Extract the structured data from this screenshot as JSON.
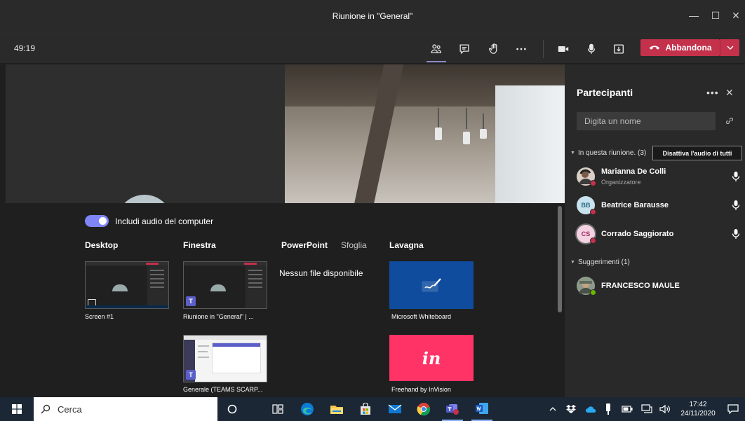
{
  "window": {
    "title": "Riunione in \"General\"",
    "controls": {
      "minimize": "—",
      "maximize": "☐",
      "close": "✕"
    }
  },
  "toolbar": {
    "timer": "49:19",
    "buttons": [
      {
        "name": "participants-icon",
        "active": true
      },
      {
        "name": "chat-icon"
      },
      {
        "name": "raise-hand-icon"
      },
      {
        "name": "more-icon"
      },
      {
        "name": "camera-icon"
      },
      {
        "name": "microphone-icon"
      },
      {
        "name": "share-tray-icon"
      }
    ],
    "leave_label": "Abbandona"
  },
  "share_tray": {
    "include_audio_label": "Includi audio del computer",
    "include_audio_on": true,
    "columns": {
      "desktop": "Desktop",
      "window": "Finestra",
      "powerpoint": "PowerPoint",
      "browse": "Sfoglia",
      "whiteboard": "Lavagna"
    },
    "desktop_items": [
      "Screen #1"
    ],
    "window_items": [
      "Riunione in \"General\" | ...",
      "Generale (TEAMS SCARP..."
    ],
    "powerpoint_empty": "Nessun file disponibile",
    "whiteboard_items": [
      "Microsoft Whiteboard",
      "Freehand by InVision"
    ],
    "invision_logo": "in"
  },
  "participants": {
    "title": "Partecipanti",
    "more": "•••",
    "close": "✕",
    "search_placeholder": "Digita un nome",
    "in_meeting_label": "In questa riunione. (3)",
    "mute_all_label": "Disattiva l'audio di tutti",
    "in_meeting": [
      {
        "name": "Marianna De Colli",
        "role": "Organizzatore",
        "avatar": "photo",
        "status_color": "#c4314b",
        "mic": true
      },
      {
        "name": "Beatrice Barausse",
        "initials": "BB",
        "avatar_bg": "#c9e3ee",
        "avatar_fg": "#2c6a86",
        "status_color": "#c4314b",
        "mic": true
      },
      {
        "name": "Corrado Saggiorato",
        "initials": "CS",
        "avatar_bg": "#f4d2e1",
        "avatar_fg": "#a02b60",
        "status_color": "#c4314b",
        "mic": true
      }
    ],
    "suggestions_label": "Suggerimenti (1)",
    "suggestions": [
      {
        "name": "FRANCESCO MAULE",
        "avatar": "photo",
        "status_color": "#6bb700"
      }
    ]
  },
  "taskbar": {
    "search_placeholder": "Cerca",
    "time": "17:42",
    "date": "24/11/2020"
  },
  "colors": {
    "accent": "#7f85f5",
    "leave": "#c4314b",
    "panel": "#292929"
  }
}
